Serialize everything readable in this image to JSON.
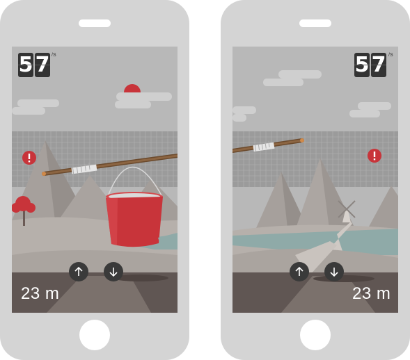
{
  "phones": [
    {
      "timer": {
        "digits": [
          "5",
          "7"
        ],
        "unit": "/S"
      },
      "distance": "23 m",
      "controls": {
        "up": "arrow-up-icon",
        "down": "arrow-down-icon"
      },
      "alert": "exclamation-icon"
    },
    {
      "timer": {
        "digits": [
          "5",
          "7"
        ],
        "unit": "/S"
      },
      "distance": "23 m",
      "controls": {
        "up": "arrow-up-icon",
        "down": "arrow-down-icon"
      },
      "alert": "exclamation-icon"
    }
  ],
  "colors": {
    "accent_red": "#c8343a",
    "phone_frame": "#d4d4d4",
    "sky": "#b7b7b7",
    "water": "#8faaa8"
  }
}
